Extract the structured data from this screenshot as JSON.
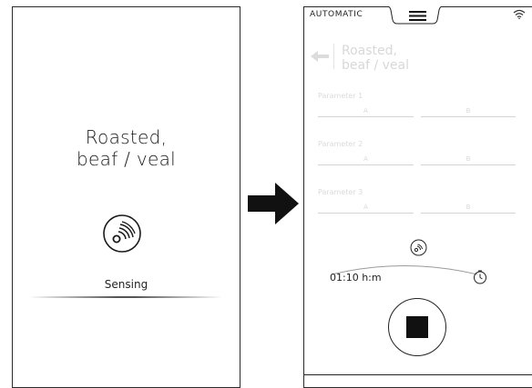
{
  "left_screen": {
    "title_line1": "Roasted,",
    "title_line2": "beaf / veal",
    "status": "Sensing",
    "icon": "sensing-icon"
  },
  "transition": {
    "icon": "arrow-right-icon"
  },
  "right_screen": {
    "mode_label": "AUTOMATIC",
    "menu_icon": "hamburger-icon",
    "wifi_icon": "wifi-icon",
    "back_icon": "back-arrow-icon",
    "title_line1": "Roasted,",
    "title_line2": "beaf / veal",
    "parameters": [
      {
        "label": "Parameter 1",
        "field_a": "A",
        "field_b": "B"
      },
      {
        "label": "Parameter 2",
        "field_a": "A",
        "field_b": "B"
      },
      {
        "label": "Parameter 3",
        "field_a": "A",
        "field_b": "B"
      }
    ],
    "time": "01:10 h:m",
    "clock_icon": "clock-icon",
    "stop_icon": "stop-icon"
  }
}
